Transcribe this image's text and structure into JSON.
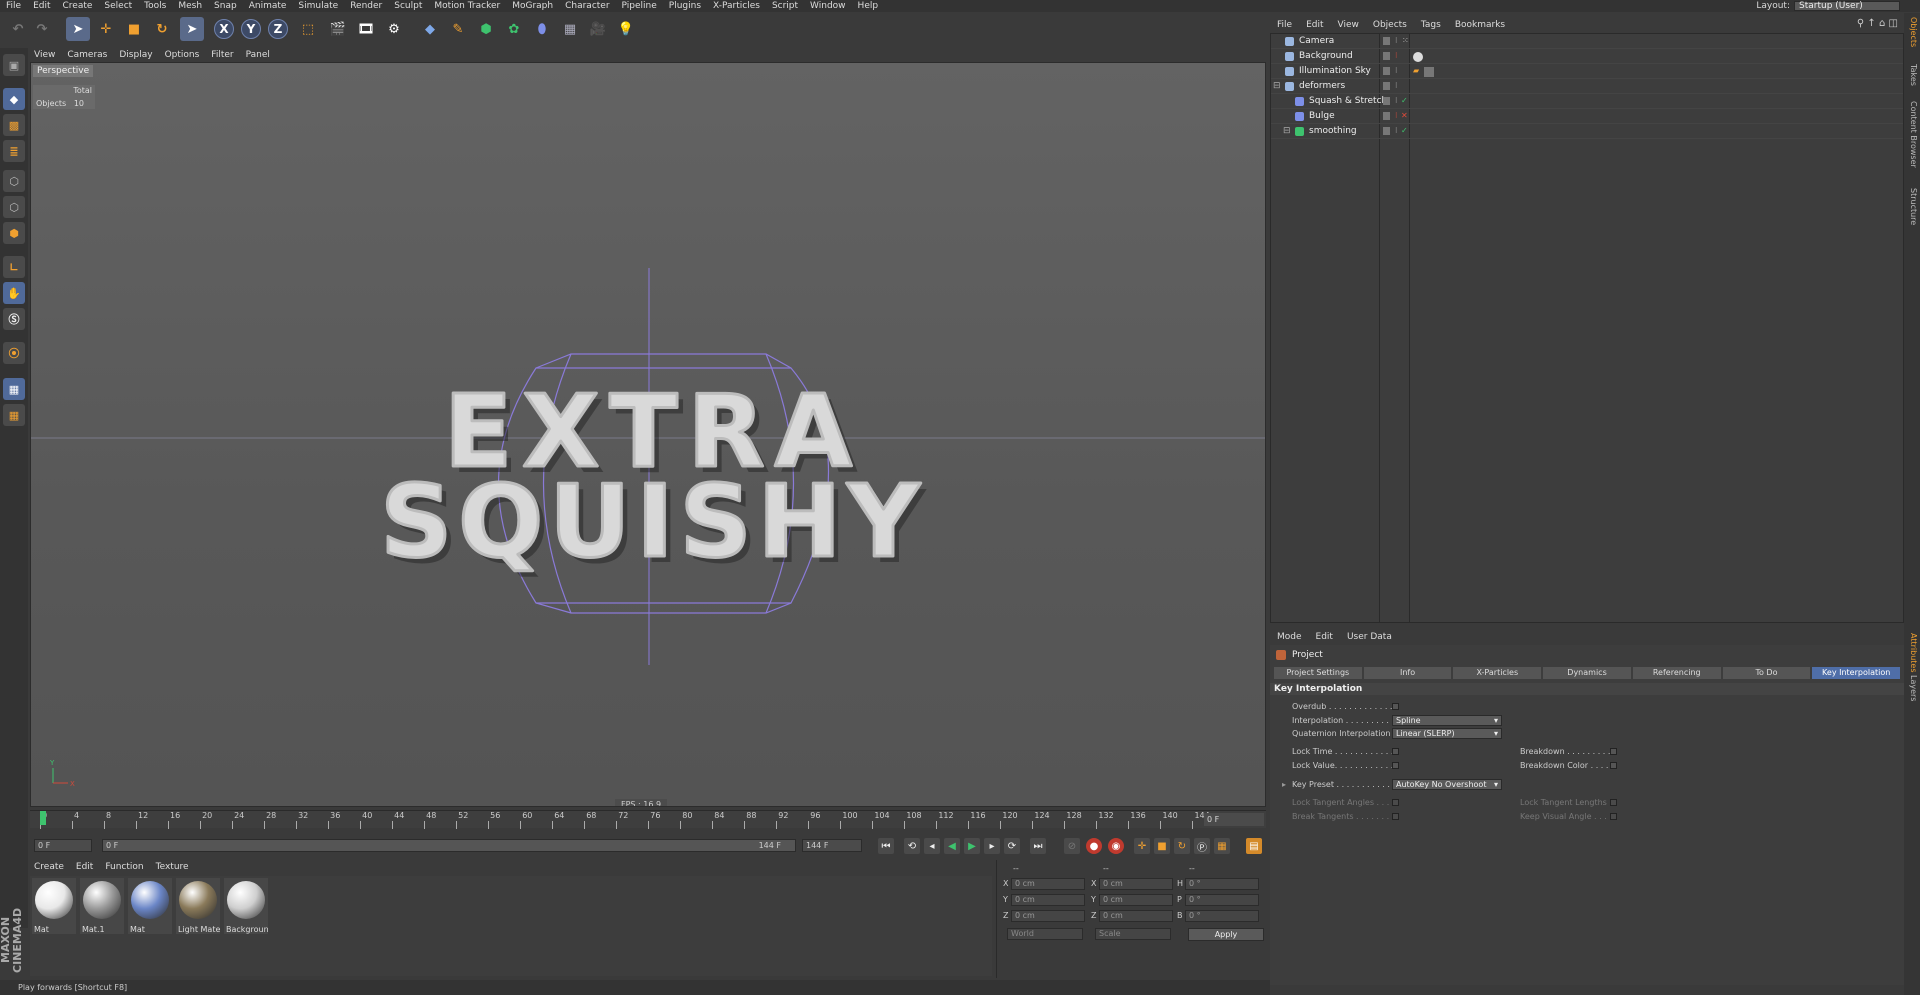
{
  "menu": [
    "File",
    "Edit",
    "Create",
    "Select",
    "Tools",
    "Mesh",
    "Snap",
    "Animate",
    "Simulate",
    "Render",
    "Sculpt",
    "Motion Tracker",
    "MoGraph",
    "Character",
    "Pipeline",
    "Plugins",
    "X-Particles",
    "Script",
    "Window",
    "Help"
  ],
  "layout": {
    "label": "Layout:",
    "value": "Startup (User)"
  },
  "toolbar": {
    "axis_x": "X",
    "axis_y": "Y",
    "axis_z": "Z"
  },
  "viewport": {
    "menu": [
      "View",
      "Cameras",
      "Display",
      "Options",
      "Filter",
      "Panel"
    ],
    "label": "Perspective",
    "stats_header": "Total",
    "stats_label": "Objects",
    "stats_value": "10",
    "text_line1": "EXTRA",
    "text_line2": "SQUISHY",
    "fps": "FPS : 16.9",
    "axis_y": "Y",
    "axis_x": "X"
  },
  "timeline": {
    "ticks": [
      "0",
      "4",
      "8",
      "12",
      "16",
      "20",
      "24",
      "28",
      "32",
      "36",
      "40",
      "44",
      "48",
      "52",
      "56",
      "60",
      "64",
      "68",
      "72",
      "76",
      "80",
      "84",
      "88",
      "92",
      "96",
      "100",
      "104",
      "108",
      "112",
      "116",
      "120",
      "124",
      "128",
      "132",
      "136",
      "140",
      "144"
    ],
    "current_frame": "0 F",
    "start_frame": "0 F",
    "range_start": "0 F",
    "range_end": "144 F",
    "end_frame": "144 F"
  },
  "materials": {
    "menu": [
      "Create",
      "Edit",
      "Function",
      "Texture"
    ],
    "items": [
      {
        "name": "Mat",
        "color": "#e8e8e8"
      },
      {
        "name": "Mat.1",
        "color": "#9a9a9a"
      },
      {
        "name": "Mat",
        "color": "#6b86c7"
      },
      {
        "name": "Light Mate",
        "color": "#8a7a5a"
      },
      {
        "name": "Backgroun",
        "color": "#cfcfcf"
      }
    ]
  },
  "coordinates": {
    "rows": [
      {
        "a": "X",
        "av": "0 cm",
        "b": "X",
        "bv": "0 cm",
        "c": "H",
        "cv": "0 °"
      },
      {
        "a": "Y",
        "av": "0 cm",
        "b": "Y",
        "bv": "0 cm",
        "c": "P",
        "cv": "0 °"
      },
      {
        "a": "Z",
        "av": "0 cm",
        "b": "Z",
        "bv": "0 cm",
        "c": "B",
        "cv": "0 °"
      }
    ],
    "header_a": "--",
    "header_b": "--",
    "header_c": "--",
    "world": "World",
    "scale": "Scale",
    "apply": "Apply"
  },
  "status": "Play forwards [Shortcut F8]",
  "logo": "MAXON CINEMA4D",
  "object_manager": {
    "menu": [
      "File",
      "Edit",
      "View",
      "Objects",
      "Tags",
      "Bookmarks"
    ],
    "objects": [
      {
        "name": "Camera",
        "indent": 0,
        "icon": "camera-icon",
        "color": "#9bb7e0"
      },
      {
        "name": "Background",
        "indent": 0,
        "icon": "background-icon",
        "color": "#9bb7e0"
      },
      {
        "name": "Illumination Sky",
        "indent": 0,
        "icon": "sky-icon",
        "color": "#9bb7e0"
      },
      {
        "name": "deformers",
        "indent": 0,
        "icon": "null-icon",
        "color": "#9bb7e0"
      },
      {
        "name": "Squash & Stretch",
        "indent": 1,
        "icon": "squash-stretch-icon",
        "color": "#7d8fe8"
      },
      {
        "name": "Bulge",
        "indent": 1,
        "icon": "bulge-icon",
        "color": "#7d8fe8"
      },
      {
        "name": "smoothing",
        "indent": 1,
        "icon": "smoothing-icon",
        "color": "#3ec36e"
      }
    ]
  },
  "attributes": {
    "menu": [
      "Mode",
      "Edit",
      "User Data"
    ],
    "title": "Project",
    "tabs": [
      "Project Settings",
      "Info",
      "X-Particles",
      "Dynamics",
      "Referencing",
      "To Do",
      "Key Interpolation"
    ],
    "active_tab": "Key Interpolation",
    "section": "Key Interpolation",
    "overdub": "Overdub . . . . . . . . . . . . .",
    "interpolation_label": "Interpolation . . . . . . . . . .",
    "interpolation_value": "Spline",
    "quaternion_label": "Quaternion Interpolation",
    "quaternion_value": "Linear (SLERP)",
    "lock_time": "Lock Time . . . . . . . . . . . .",
    "lock_value": "Lock Value. . . . . . . . . . . .",
    "breakdown": "Breakdown . . . . . . . . . .",
    "breakdown_color": "Breakdown Color . . . . .",
    "key_preset_label": "Key Preset . . . . . . . . . . .",
    "key_preset_value": "AutoKey No Overshoot",
    "lock_tangent_angles": "Lock Tangent Angles . . .",
    "break_tangents": "Break Tangents . . . . . . .",
    "lock_tangent_lengths": "Lock Tangent Lengths",
    "keep_visual_angle": "Keep Visual Angle . . . ."
  },
  "edge_tabs": [
    "Objects",
    "Takes",
    "Content Browser",
    "Structure",
    "Attributes",
    "Layers"
  ]
}
